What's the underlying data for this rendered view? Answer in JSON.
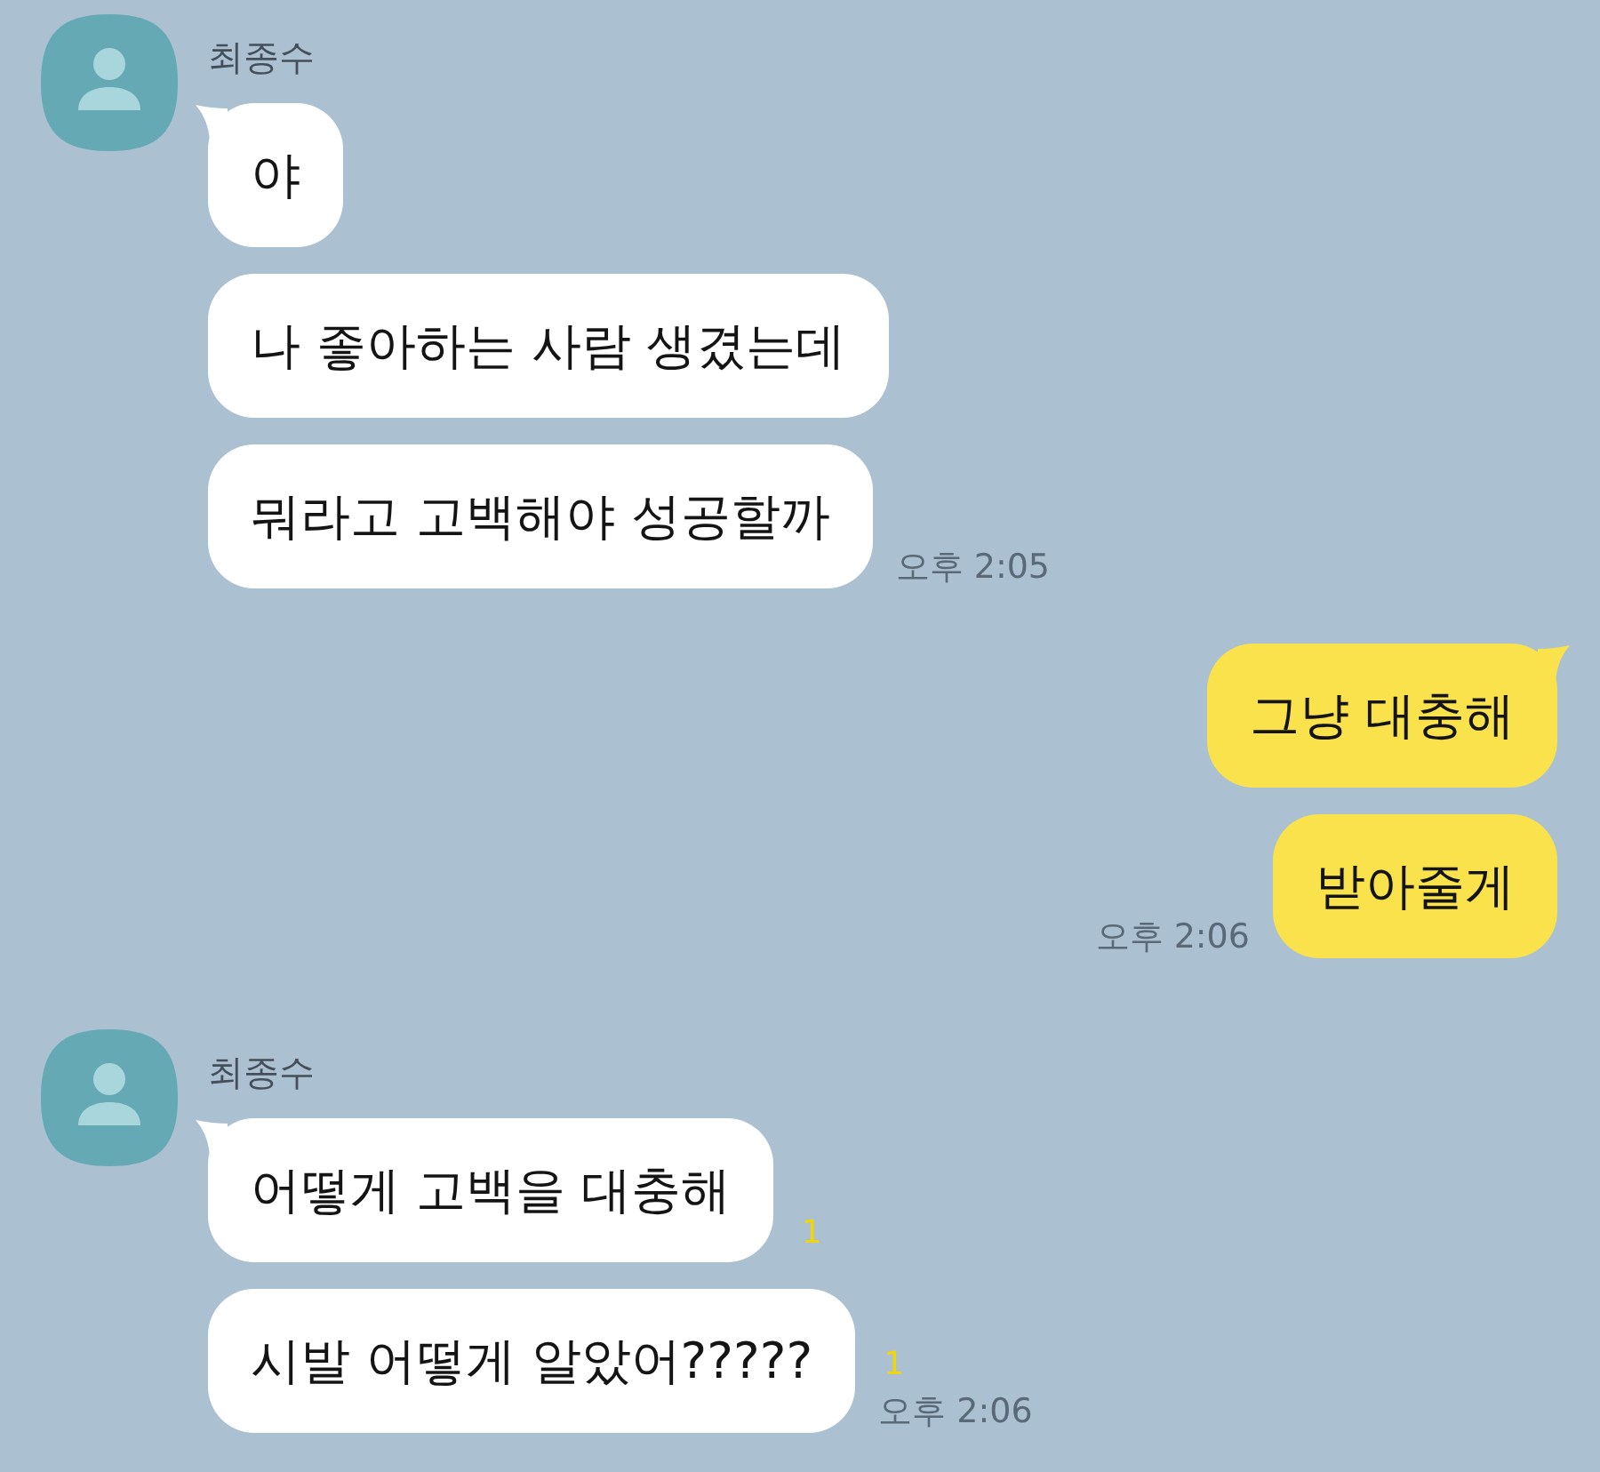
{
  "groups": [
    {
      "kind": "received",
      "sender": "최종수",
      "bubbles": [
        {
          "text": "야",
          "tail": true
        },
        {
          "text": "나 좋아하는 사람 생겼는데",
          "tail": false
        },
        {
          "text": "뭐라고 고백해야 성공할까",
          "tail": false,
          "time": "오후 2:05"
        }
      ]
    },
    {
      "kind": "sent",
      "bubbles": [
        {
          "text": "그냥 대충해",
          "tail": true
        },
        {
          "text": "받아줄게",
          "tail": false,
          "time": "오후 2:06"
        }
      ]
    },
    {
      "kind": "received",
      "sender": "최종수",
      "bubbles": [
        {
          "text": "어떻게 고백을 대충해",
          "tail": true,
          "unread": "1"
        },
        {
          "text": "시발 어떻게 알았어?????",
          "tail": false,
          "unread": "1",
          "time": "오후 2:06"
        }
      ]
    }
  ]
}
